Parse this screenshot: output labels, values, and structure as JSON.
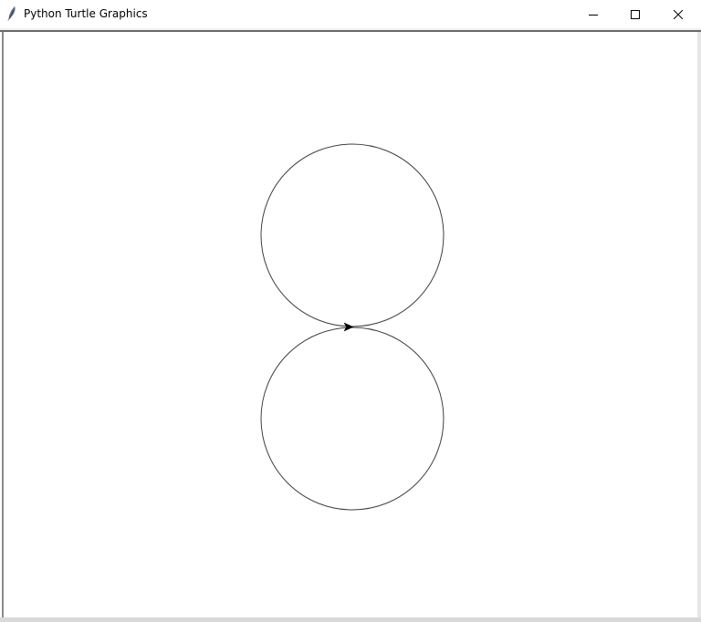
{
  "window": {
    "title": "Python Turtle Graphics",
    "icon": "feather-icon",
    "controls": {
      "minimize": "minimize-icon",
      "maximize": "maximize-icon",
      "close": "close-icon"
    }
  },
  "canvas": {
    "background": "#ffffff",
    "pen_color": "#000000",
    "shapes": [
      {
        "kind": "circle",
        "name": "upper-circle"
      },
      {
        "kind": "circle",
        "name": "lower-circle"
      }
    ],
    "turtle": {
      "shape": "arrow",
      "heading_deg": 0
    }
  }
}
